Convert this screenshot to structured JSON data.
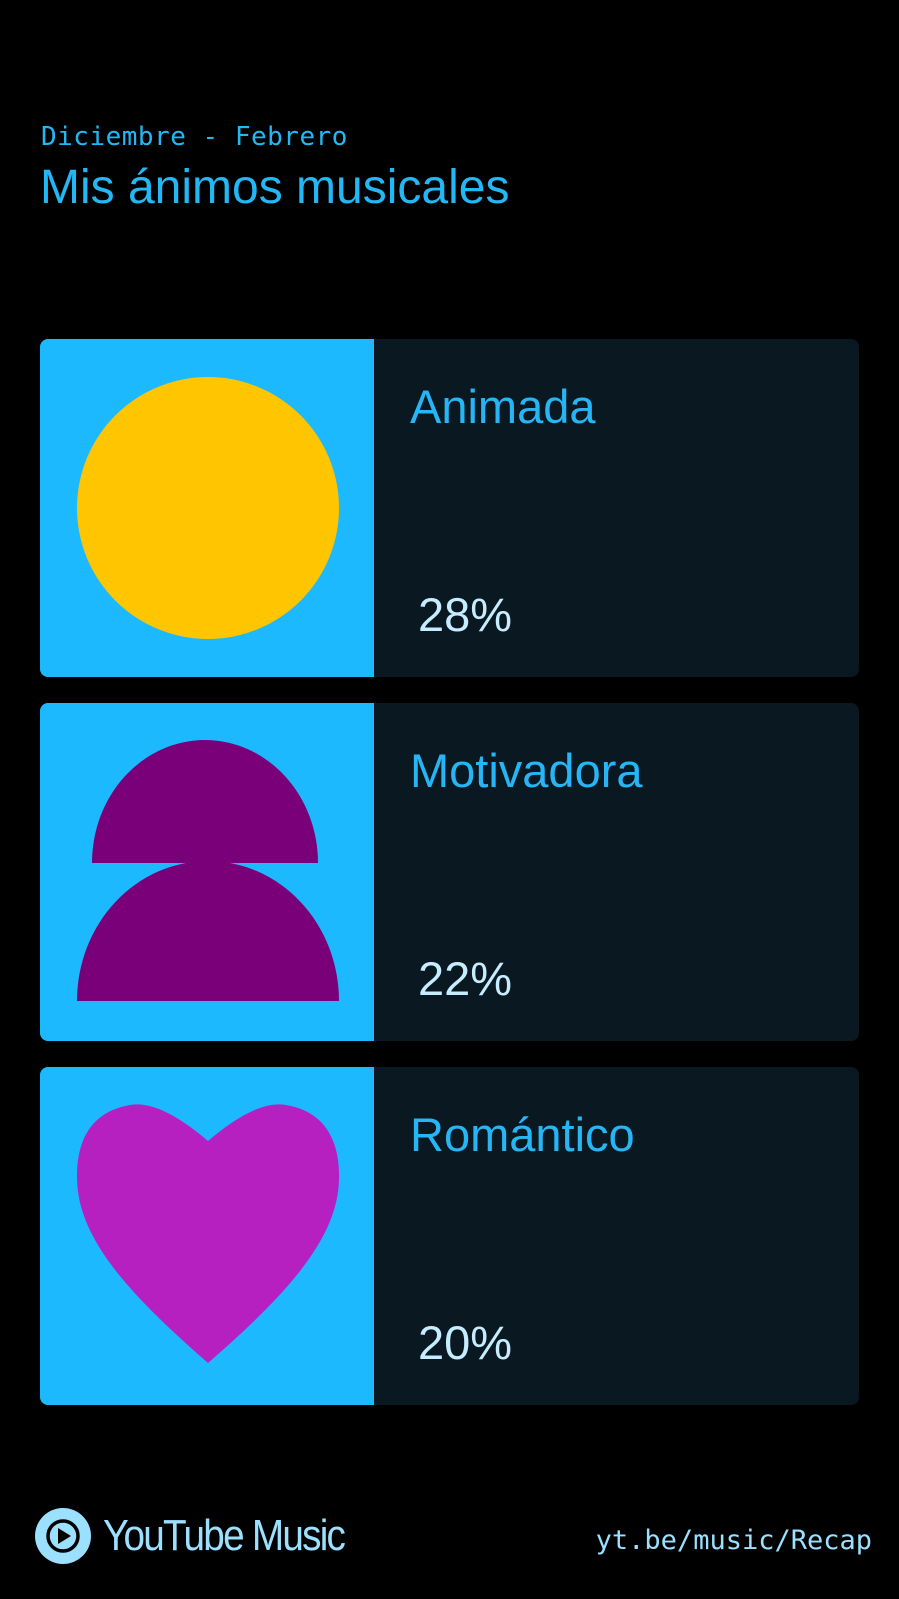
{
  "header": {
    "period": "Diciembre - Febrero",
    "title": "Mis ánimos musicales"
  },
  "moods": [
    {
      "label": "Animada",
      "percent": "28%",
      "shape": "sun-circle-icon",
      "color": "#ffc600"
    },
    {
      "label": "Motivadora",
      "percent": "22%",
      "shape": "stacked-semicircles-icon",
      "color": "#7a007a"
    },
    {
      "label": "Romántico",
      "percent": "20%",
      "shape": "heart-icon",
      "color": "#b720c0"
    }
  ],
  "footer": {
    "brand": "YouTube Music",
    "url": "yt.be/music/Recap"
  },
  "colors": {
    "background": "#000000",
    "accent": "#22b8f5",
    "card_art_bg": "#1db9ff",
    "card_info_bg": "#091821",
    "percent_text": "#c6ecff",
    "footer_text": "#9be0ff"
  }
}
